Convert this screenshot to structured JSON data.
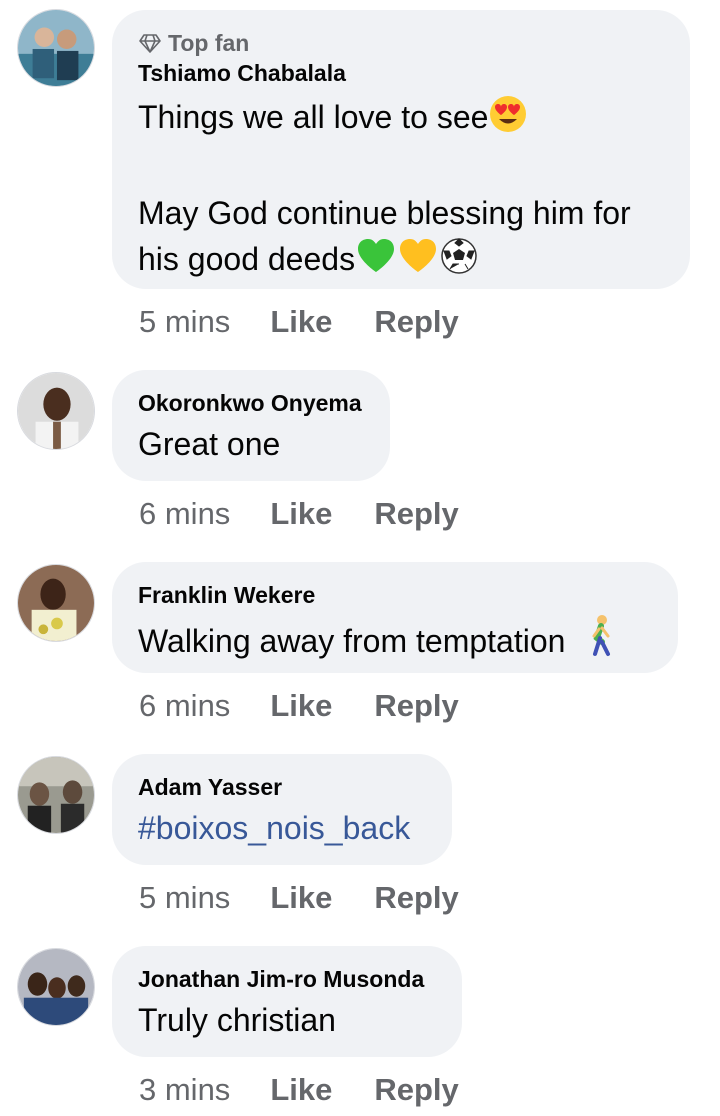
{
  "comments": [
    {
      "badge": "Top fan",
      "name": "Tshiamo Chabalala",
      "line1": "Things we all love to see",
      "line2": "May God continue blessing him for",
      "line3": "his good deeds",
      "time": "5 mins",
      "like": "Like",
      "reply": "Reply"
    },
    {
      "name": "Okoronkwo Onyema",
      "text": "Great one",
      "time": "6 mins",
      "like": "Like",
      "reply": "Reply"
    },
    {
      "name": "Franklin Wekere",
      "text": "Walking away from temptation",
      "time": "6 mins",
      "like": "Like",
      "reply": "Reply"
    },
    {
      "name": "Adam Yasser",
      "text": "#boixos_nois_back",
      "time": "5 mins",
      "like": "Like",
      "reply": "Reply"
    },
    {
      "name": "Jonathan Jim-ro Musonda",
      "text": "Truly christian",
      "time": "3 mins",
      "like": "Like",
      "reply": "Reply"
    }
  ],
  "colors": {
    "bubble": "#f0f2f5",
    "meta": "#65676b",
    "hashtag": "#385898"
  },
  "icons": [
    "diamond-icon",
    "heart-eyes-emoji",
    "green-heart-emoji",
    "yellow-heart-emoji",
    "soccer-ball-emoji",
    "walking-person-emoji"
  ]
}
